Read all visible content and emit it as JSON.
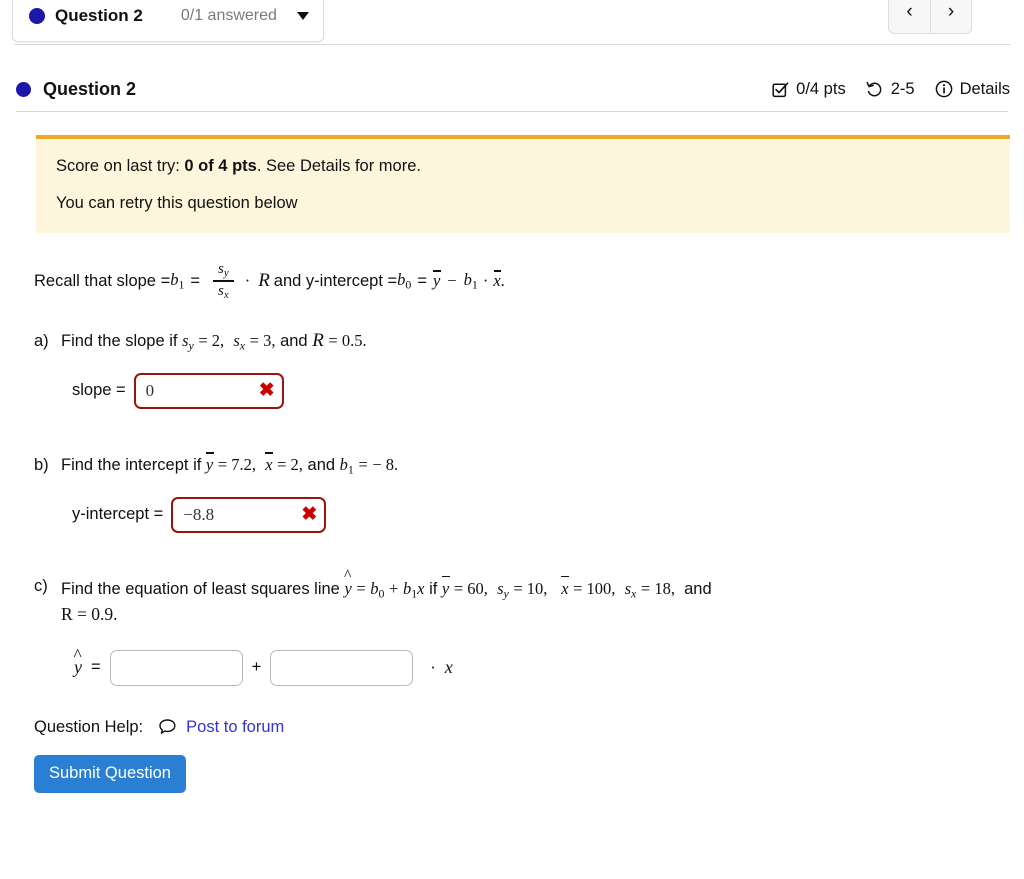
{
  "tab": {
    "title": "Question 2",
    "answered": "0/1 answered",
    "caret_icon": "chevron-down-icon",
    "dot_color": "#1b17a8"
  },
  "nav": {
    "prev_label": "‹",
    "next_label": "›"
  },
  "question_header": {
    "title": "Question 2",
    "points": "0/4 pts",
    "attempts": "2-5",
    "details_label": "Details",
    "points_icon": "checkbox-checked-icon",
    "attempts_icon": "undo-retry-icon",
    "details_icon": "info-circle-icon"
  },
  "alert": {
    "line1_prefix": "Score on last try: ",
    "line1_bold": "0 of 4 pts",
    "line1_suffix": ". See Details for more.",
    "line2": "You can retry this question below",
    "bg_color": "#fdf6dd",
    "border_color": "#f0a828"
  },
  "recall": {
    "lead": "Recall that slope = ",
    "b1": "b",
    "b1_sub": "1",
    "eq1": "=",
    "num": "s",
    "num_sub": "y",
    "den": "s",
    "den_sub": "x",
    "dot": "·",
    "R": "R",
    "mid": " and y-intercept = ",
    "b0": "b",
    "b0_sub": "0",
    "eq2": "=",
    "ybar": "y",
    "minus": "−",
    "b1b": "b",
    "b1b_sub": "1",
    "dot2": "·",
    "xbar": "x",
    "period": "."
  },
  "parts": [
    {
      "label": "a)",
      "text_lead": "Find the slope if ",
      "sy": "s",
      "sy_sub": "y",
      "sy_eq": "= 2,",
      "sx": "s",
      "sx_sub": "x",
      "sx_eq": "= 3,",
      "and": "and",
      "R": "R",
      "R_eq": "= 0.5.",
      "answer_label": "slope =",
      "answer_value": "0",
      "answer_state": "incorrect",
      "mark_icon": "x-mark-icon"
    },
    {
      "label": "b)",
      "text_lead": "Find the intercept if ",
      "ybar": "y",
      "ybar_eq": "= 7.2,",
      "xbar": "x",
      "xbar_eq": "= 2,",
      "and": "and",
      "b1": "b",
      "b1_sub": "1",
      "b1_eq": "=",
      "b1_val": "− 8.",
      "answer_label": "y-intercept =",
      "answer_value": "−8.8",
      "answer_state": "incorrect",
      "mark_icon": "x-mark-icon"
    },
    {
      "label": "c)",
      "text_lead": "Find the equation of least squares line ",
      "yhat": "y",
      "eq": "=",
      "b0": "b",
      "b0_sub": "0",
      "plus": "+",
      "b1": "b",
      "b1_sub": "1",
      "x": "x",
      "if": "if",
      "ybar": "y",
      "ybar_eq": "= 60,",
      "sy": "s",
      "sy_sub": "y",
      "sy_eq": "= 10,",
      "xbar": "x",
      "xbar_eq": "= 100,",
      "sx": "s",
      "sx_sub": "x",
      "sx_eq": "= 18,",
      "and": "and",
      "R_line": "R = 0.9.",
      "eq_yhat": "y",
      "eq_equals": "=",
      "eq_plus": "+",
      "eq_dot": "·",
      "eq_x": "x",
      "input1_value": "",
      "input2_value": ""
    }
  ],
  "footer": {
    "help_label": "Question Help:",
    "forum_link": "Post to forum",
    "forum_icon": "speech-bubble-icon",
    "forum_color": "#3333dd",
    "submit_label": "Submit Question",
    "submit_color": "#2a7fd4"
  }
}
